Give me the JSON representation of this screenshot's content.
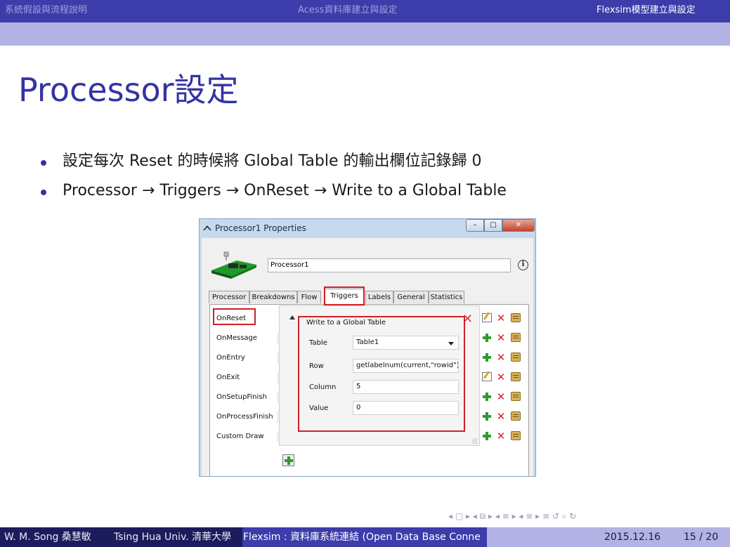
{
  "header": {
    "left": "系統假設與流程說明",
    "middle": "Acess資料庫建立與設定",
    "right": "Flexsim模型建立與設定"
  },
  "slide": {
    "title": "Processor設定",
    "bullets": [
      "設定每次 Reset 的時候將 Global Table 的輸出欄位記錄歸 0",
      "Processor → Triggers → OnReset → Write to a Global Table"
    ]
  },
  "dialog": {
    "title": "Processor1  Properties",
    "window_buttons": {
      "minimize": "–",
      "maximize": "□",
      "close": "✕"
    },
    "object_name": "Processor1",
    "info_label": "i",
    "tabs": [
      "Processor",
      "Breakdowns",
      "Flow",
      "Triggers",
      "Labels",
      "General",
      "Statistics"
    ],
    "active_tab": "Triggers",
    "triggers": [
      "OnReset",
      "OnMessage",
      "OnEntry",
      "OnExit",
      "OnSetupFinish",
      "OnProcessFinish",
      "Custom Draw"
    ],
    "subpanel": {
      "title": "Write to a Global Table",
      "fields": [
        {
          "label": "Table",
          "value": "Table1",
          "type": "dropdown"
        },
        {
          "label": "Row",
          "value": "getlabelnum(current,\"rowid\")",
          "type": "text"
        },
        {
          "label": "Column",
          "value": "5",
          "type": "text"
        },
        {
          "label": "Value",
          "value": "0",
          "type": "text"
        }
      ]
    },
    "colors": {
      "highlight": "#d01f2a",
      "plus": "#2f9a2f",
      "remove": "#d7261c"
    }
  },
  "nav": {
    "symbols": "◂ ▢ ▸ ◂ ⧉ ▸ ◂ ≡ ▸ ◂ ≡ ▸  ≡  ↺ ⌕ ↻"
  },
  "footer": {
    "author": "W. M. Song 桑慧敏",
    "institution": "Tsing Hua Univ. 清華大學",
    "talk": "Flexsim : 資料庫系統連結 (Open Data Base Conne",
    "date": "2015.12.16",
    "page": "15 / 20"
  }
}
